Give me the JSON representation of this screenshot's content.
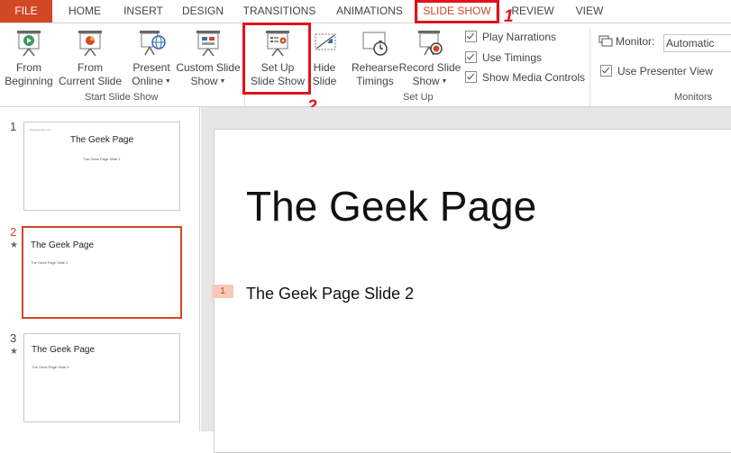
{
  "tabs": [
    {
      "label": "FILE"
    },
    {
      "label": "HOME"
    },
    {
      "label": "INSERT"
    },
    {
      "label": "DESIGN"
    },
    {
      "label": "TRANSITIONS"
    },
    {
      "label": "ANIMATIONS"
    },
    {
      "label": "SLIDE SHOW"
    },
    {
      "label": "REVIEW"
    },
    {
      "label": "VIEW"
    }
  ],
  "ribbon": {
    "start": {
      "from_beginning": [
        "From",
        "Beginning"
      ],
      "from_current": [
        "From",
        "Current Slide"
      ],
      "present_online": [
        "Present",
        "Online"
      ],
      "custom_show": [
        "Custom Slide",
        "Show"
      ],
      "group_label": "Start Slide Show"
    },
    "setup": {
      "setup_show": [
        "Set Up",
        "Slide Show"
      ],
      "hide_slide": [
        "Hide",
        "Slide"
      ],
      "rehearse": [
        "Rehearse",
        "Timings"
      ],
      "record": [
        "Record Slide",
        "Show"
      ],
      "play_narrations": {
        "label": "Play Narrations",
        "checked": true
      },
      "use_timings": {
        "label": "Use Timings",
        "checked": true
      },
      "media_controls": {
        "label": "Show Media Controls",
        "checked": true
      },
      "group_label": "Set Up"
    },
    "monitors": {
      "monitor_label": "Monitor:",
      "monitor_value": "Automatic",
      "presenter_view": {
        "label": "Use Presenter View",
        "checked": true
      },
      "group_label": "Monitors"
    }
  },
  "annotations": {
    "step1": "1",
    "step2": "2"
  },
  "slides": [
    {
      "number": "1",
      "url": "thegeekpage.com",
      "title": "The Geek Page",
      "subtitle": "The Geek Page Slide 1"
    },
    {
      "number": "2",
      "title": "The Geek Page",
      "subtitle": "The Geek Page Slide 2"
    },
    {
      "number": "3",
      "title": "The Geek Page",
      "subtitle": "The Geek Page Slide 3"
    }
  ],
  "current_slide": {
    "title": "The Geek Page",
    "subtitle": "The Geek Page Slide 2",
    "animation_tag": "1"
  },
  "colors": {
    "accent": "#d24726",
    "annotation": "#e0141e"
  }
}
